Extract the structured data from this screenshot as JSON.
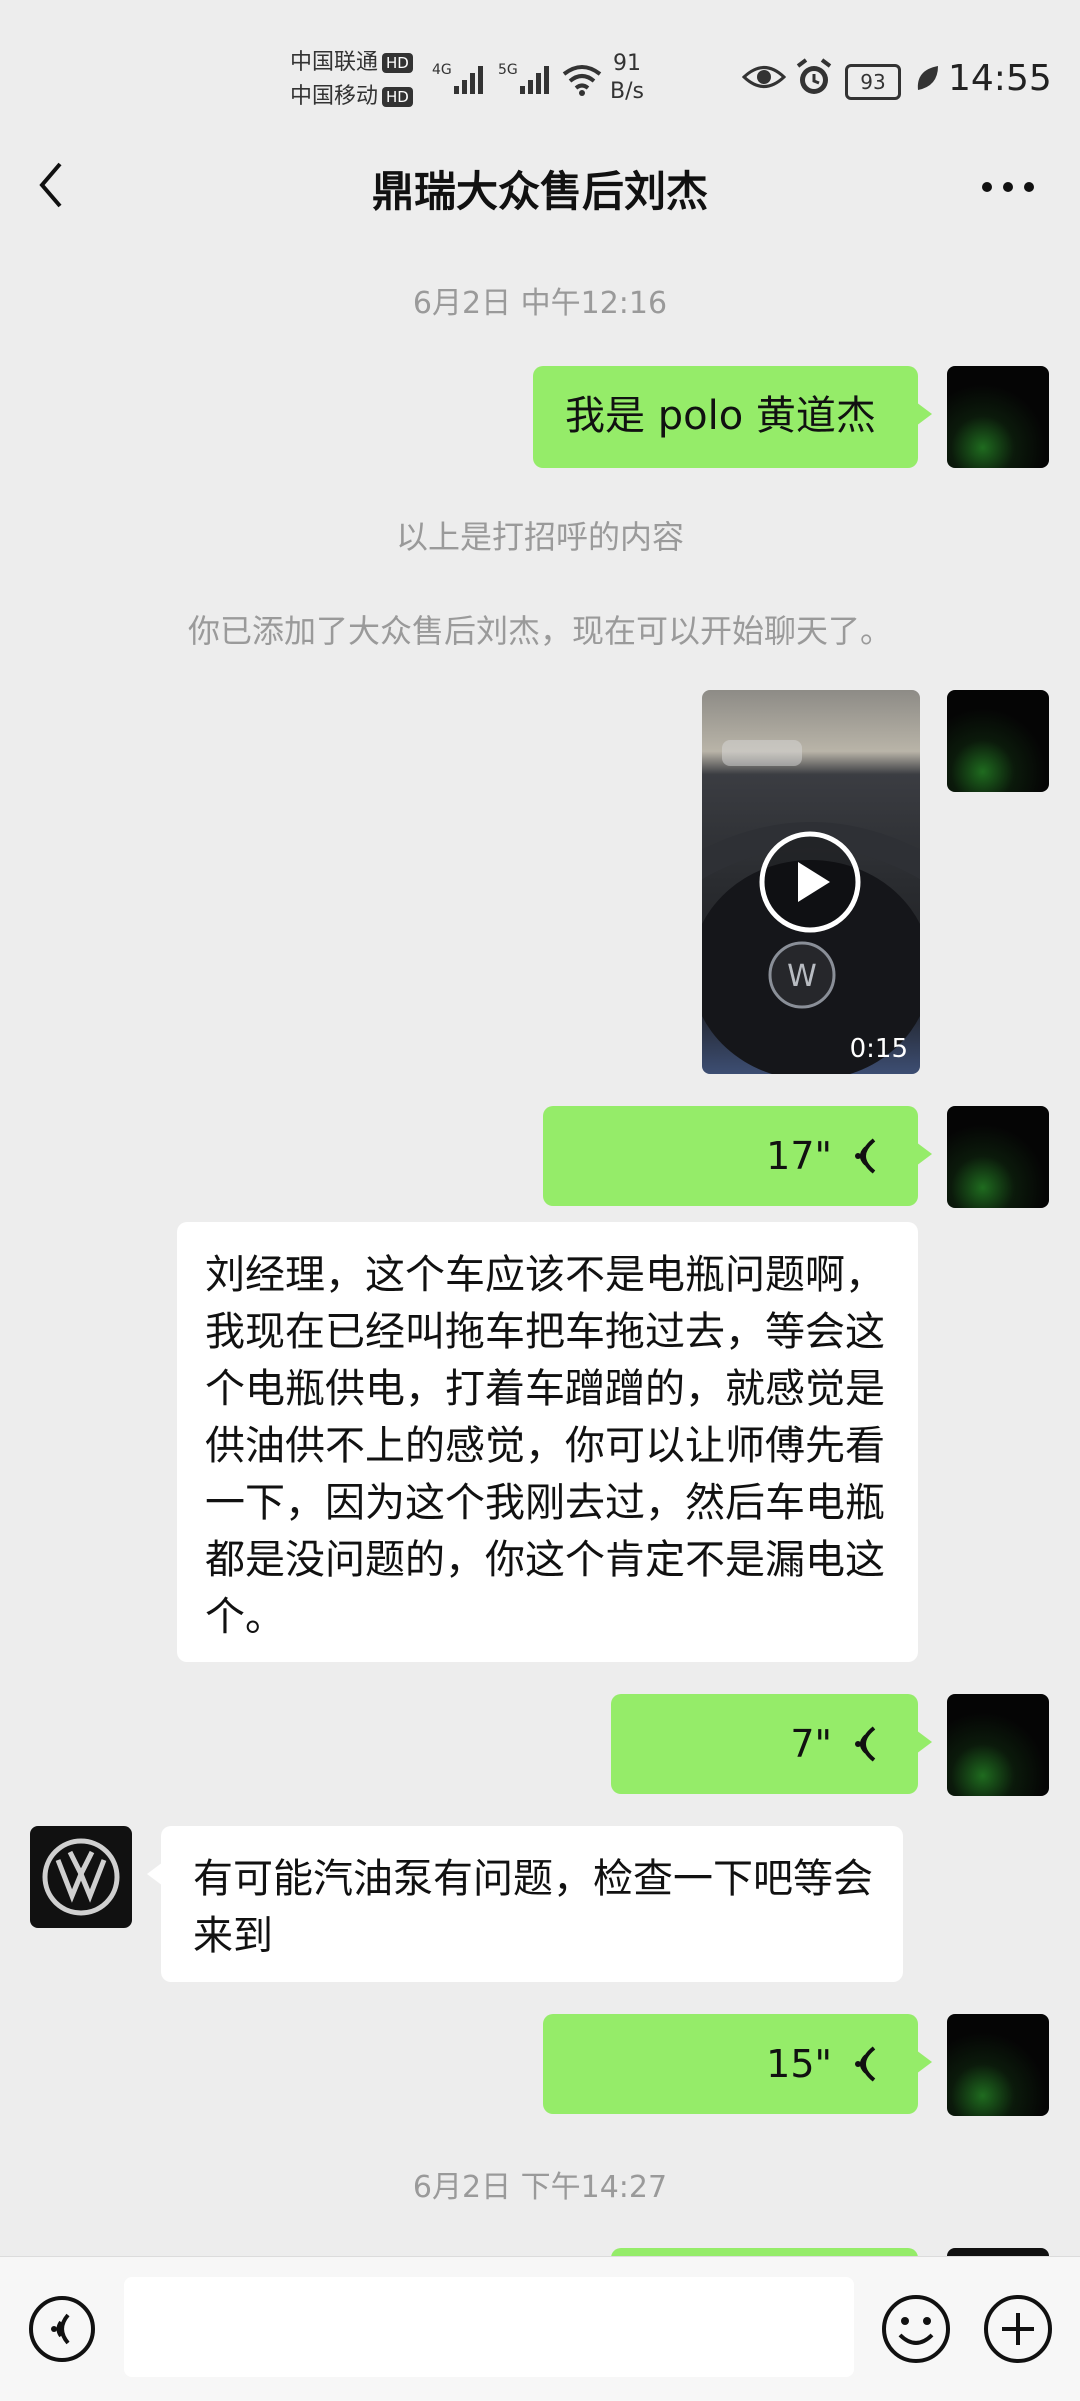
{
  "status_bar": {
    "carrier1": "中国联通",
    "carrier2": "中国移动",
    "hd": "HD",
    "net1": "4G",
    "net2": "5G",
    "speed_value": "91",
    "speed_unit": "B/s",
    "battery": "93",
    "time": "14:55"
  },
  "header": {
    "title": "鼎瑞大众售后刘杰"
  },
  "chat": {
    "timestamp1": "6月2日 中午12:16",
    "msg1": "我是 polo 黄道杰",
    "system1": "以上是打招呼的内容",
    "system2": "你已添加了大众售后刘杰，现在可以开始聊天了。",
    "video_duration": "0:15",
    "voice1": "17\"",
    "msg2": "刘经理，这个车应该不是电瓶问题啊，我现在已经叫拖车把车拖过去，等会这个电瓶供电，打着车蹭蹭的，就感觉是供油供不上的感觉，你可以让师傅先看一下，因为这个我刚去过，然后车电瓶都是没问题的，你这个肯定不是漏电这个。",
    "voice2": "7\"",
    "msg3": "有可能汽油泵有问题，检查一下吧等会来到",
    "voice3": "15\"",
    "timestamp2": "6月2日 下午14:27"
  },
  "colors": {
    "background": "#ededed",
    "my_bubble": "#95ec69",
    "their_bubble": "#ffffff"
  }
}
